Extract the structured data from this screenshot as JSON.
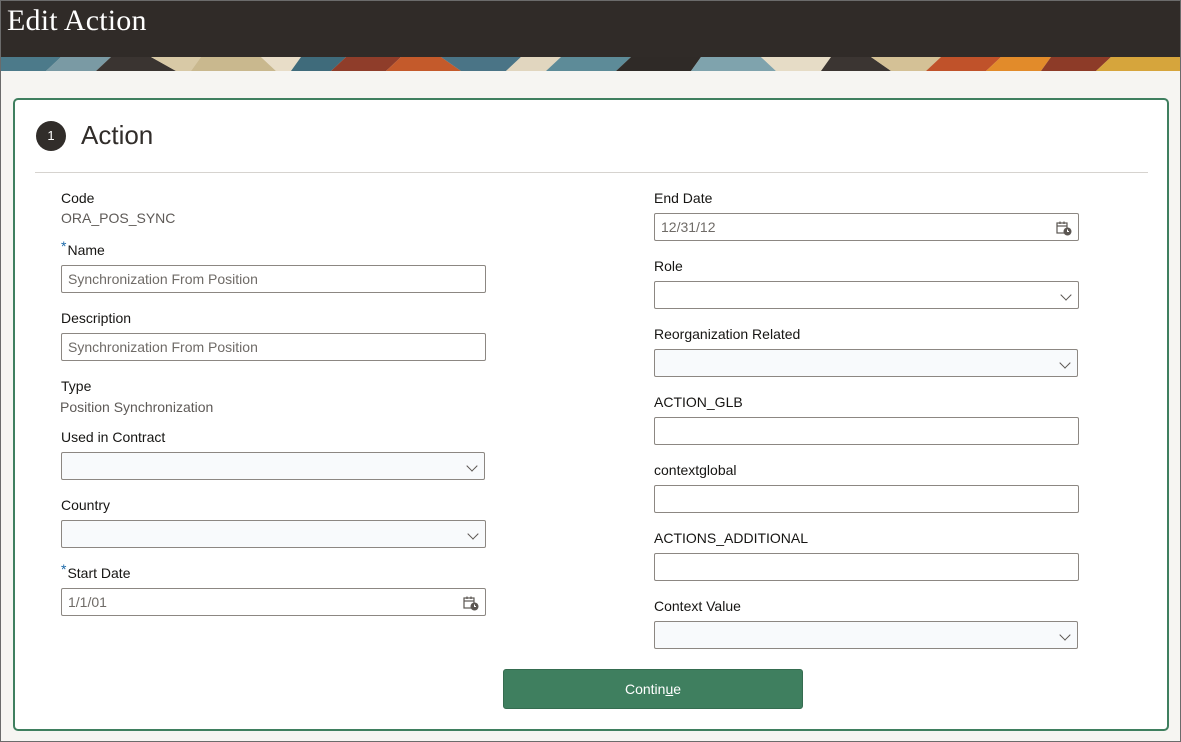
{
  "header": {
    "title": "Edit Action"
  },
  "step": {
    "number": "1",
    "title": "Action"
  },
  "left": {
    "code": {
      "label": "Code",
      "value": "ORA_POS_SYNC"
    },
    "name": {
      "required": "*",
      "label": "Name",
      "value": "Synchronization From Position"
    },
    "description": {
      "label": "Description",
      "value": "Synchronization From Position"
    },
    "type": {
      "label": "Type",
      "value": "Position Synchronization"
    },
    "used_in_contract": {
      "label": "Used in Contract",
      "value": ""
    },
    "country": {
      "label": "Country",
      "value": ""
    },
    "start_date": {
      "required": "*",
      "label": "Start Date",
      "value": "1/1/01"
    }
  },
  "right": {
    "end_date": {
      "label": "End Date",
      "value": "12/31/12"
    },
    "role": {
      "label": "Role",
      "value": ""
    },
    "reorganization_related": {
      "label": "Reorganization Related",
      "value": ""
    },
    "action_glb": {
      "label": "ACTION_GLB",
      "value": ""
    },
    "contextglobal": {
      "label": "contextglobal",
      "value": ""
    },
    "actions_additional": {
      "label": "ACTIONS_ADDITIONAL",
      "value": ""
    },
    "context_value": {
      "label": "Context Value",
      "value": ""
    }
  },
  "buttons": {
    "continue_prefix": "Contin",
    "continue_mnemonic": "u",
    "continue_suffix": "e"
  },
  "icons": {
    "dropdown": "chevron-down-icon",
    "calendar": "calendar-icon",
    "step": "step-number-circle"
  },
  "colors": {
    "header_bg": "#302b28",
    "accent_green": "#3f7f5f",
    "required_blue": "#1b68a8"
  }
}
